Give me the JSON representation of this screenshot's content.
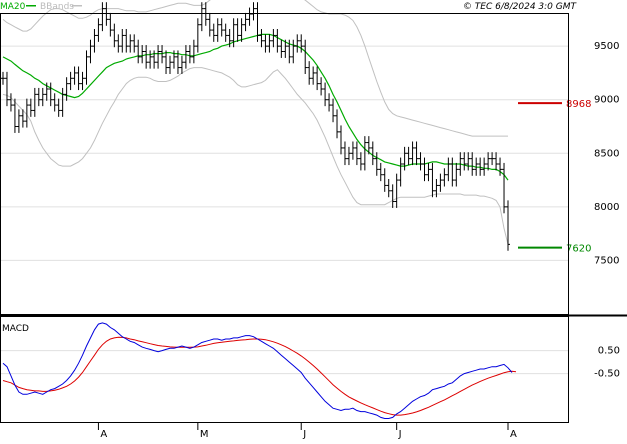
{
  "header": {
    "ma_label": "MA20",
    "bb_label": "BBands",
    "copyright": "© TEC 6/8/2024 3:0 GMT"
  },
  "colors": {
    "ma": "#00aa00",
    "bands": "#c0c0c0",
    "price": "#000000",
    "macd": "#0000dd",
    "signal": "#dd0000",
    "resistance": "#cc0000",
    "support": "#008800",
    "grid": "#e0e0e0",
    "axis": "#000000"
  },
  "chart_data": [
    {
      "type": "candlestick",
      "title": "",
      "ylim": [
        7000,
        9800
      ],
      "y_ticks": [
        7500,
        8000,
        8500,
        9000,
        9500
      ],
      "y_tick_labels": [
        "7500",
        "8000",
        "8500",
        "9000",
        "9500"
      ],
      "x_ticks": [
        {
          "index": 24,
          "label": "A"
        },
        {
          "index": 49,
          "label": "M"
        },
        {
          "index": 75,
          "label": "J"
        },
        {
          "index": 99,
          "label": "J"
        },
        {
          "index": 127,
          "label": "A"
        }
      ],
      "closes": [
        9200,
        9000,
        8950,
        8750,
        8850,
        8800,
        8950,
        8900,
        9050,
        9000,
        9050,
        9100,
        9000,
        8950,
        8900,
        9050,
        9150,
        9200,
        9250,
        9150,
        9200,
        9400,
        9500,
        9600,
        9700,
        9850,
        9750,
        9650,
        9550,
        9500,
        9600,
        9500,
        9550,
        9500,
        9400,
        9450,
        9350,
        9400,
        9350,
        9450,
        9400,
        9300,
        9350,
        9400,
        9300,
        9350,
        9450,
        9400,
        9500,
        9700,
        9850,
        9750,
        9650,
        9600,
        9700,
        9650,
        9600,
        9550,
        9700,
        9600,
        9700,
        9750,
        9800,
        9850,
        9600,
        9550,
        9500,
        9550,
        9600,
        9500,
        9450,
        9500,
        9400,
        9500,
        9550,
        9500,
        9300,
        9200,
        9250,
        9150,
        9100,
        9000,
        8950,
        8850,
        8700,
        8550,
        8450,
        8500,
        8550,
        8450,
        8400,
        8600,
        8550,
        8450,
        8350,
        8300,
        8200,
        8150,
        8050,
        8250,
        8400,
        8500,
        8450,
        8550,
        8450,
        8400,
        8300,
        8350,
        8150,
        8200,
        8250,
        8300,
        8400,
        8250,
        8350,
        8450,
        8400,
        8450,
        8350,
        8400,
        8350,
        8400,
        8450,
        8450,
        8400,
        8350,
        8000,
        7650
      ],
      "series": [
        {
          "name": "MA20",
          "values": [
            9400,
            9380,
            9360,
            9330,
            9300,
            9270,
            9250,
            9230,
            9200,
            9180,
            9150,
            9130,
            9110,
            9090,
            9070,
            9050,
            9040,
            9030,
            9020,
            9030,
            9060,
            9100,
            9140,
            9180,
            9220,
            9260,
            9300,
            9320,
            9340,
            9350,
            9360,
            9380,
            9390,
            9400,
            9410,
            9410,
            9420,
            9420,
            9430,
            9430,
            9430,
            9440,
            9440,
            9430,
            9430,
            9420,
            9420,
            9410,
            9410,
            9420,
            9430,
            9440,
            9450,
            9470,
            9480,
            9500,
            9510,
            9520,
            9540,
            9550,
            9560,
            9570,
            9580,
            9590,
            9600,
            9610,
            9610,
            9610,
            9600,
            9580,
            9560,
            9540,
            9520,
            9510,
            9500,
            9480,
            9450,
            9410,
            9370,
            9320,
            9260,
            9200,
            9130,
            9050,
            8980,
            8900,
            8820,
            8750,
            8690,
            8630,
            8580,
            8540,
            8510,
            8480,
            8460,
            8440,
            8420,
            8410,
            8400,
            8390,
            8380,
            8380,
            8390,
            8400,
            8400,
            8400,
            8400,
            8410,
            8420,
            8420,
            8410,
            8400,
            8400,
            8400,
            8400,
            8400,
            8390,
            8380,
            8380,
            8370,
            8370,
            8360,
            8360,
            8350,
            8350,
            8330,
            8300,
            8250
          ]
        },
        {
          "name": "BBands upper",
          "values": [
            9750,
            9720,
            9700,
            9680,
            9660,
            9640,
            9640,
            9660,
            9700,
            9740,
            9780,
            9810,
            9840,
            9850,
            9850,
            9840,
            9820,
            9800,
            9780,
            9760,
            9760,
            9770,
            9790,
            9820,
            9840,
            9850,
            9850,
            9850,
            9850,
            9850,
            9840,
            9830,
            9830,
            9830,
            9820,
            9820,
            9820,
            9830,
            9840,
            9850,
            9860,
            9870,
            9880,
            9890,
            9900,
            9900,
            9900,
            9890,
            9880,
            9880,
            9880,
            9900,
            9930,
            9950,
            9960,
            9970,
            9980,
            9990,
            10000,
            10000,
            10000,
            10000,
            10000,
            10000,
            10000,
            9990,
            9980,
            9970,
            9970,
            9990,
            10000,
            9990,
            9980,
            9970,
            9960,
            9950,
            9930,
            9900,
            9870,
            9840,
            9820,
            9810,
            9800,
            9800,
            9800,
            9800,
            9790,
            9770,
            9740,
            9680,
            9600,
            9500,
            9390,
            9280,
            9170,
            9070,
            8980,
            8910,
            8870,
            8850,
            8840,
            8830,
            8820,
            8810,
            8800,
            8790,
            8780,
            8770,
            8760,
            8750,
            8740,
            8730,
            8720,
            8710,
            8700,
            8690,
            8680,
            8670,
            8660,
            8660,
            8660,
            8660,
            8660,
            8660,
            8660,
            8660,
            8660,
            8660
          ]
        },
        {
          "name": "BBands lower",
          "values": [
            9050,
            9040,
            9020,
            8980,
            8940,
            8900,
            8860,
            8800,
            8700,
            8620,
            8550,
            8500,
            8450,
            8420,
            8390,
            8380,
            8380,
            8380,
            8400,
            8420,
            8450,
            8500,
            8550,
            8620,
            8700,
            8780,
            8850,
            8920,
            8980,
            9050,
            9100,
            9150,
            9180,
            9200,
            9210,
            9210,
            9210,
            9200,
            9180,
            9170,
            9170,
            9170,
            9180,
            9200,
            9220,
            9250,
            9270,
            9290,
            9300,
            9300,
            9300,
            9290,
            9280,
            9270,
            9260,
            9250,
            9230,
            9210,
            9180,
            9140,
            9120,
            9120,
            9130,
            9140,
            9150,
            9160,
            9180,
            9220,
            9260,
            9280,
            9240,
            9200,
            9150,
            9100,
            9050,
            9010,
            8970,
            8920,
            8870,
            8810,
            8730,
            8650,
            8560,
            8470,
            8380,
            8300,
            8230,
            8160,
            8090,
            8040,
            8020,
            8020,
            8020,
            8020,
            8020,
            8020,
            8020,
            8040,
            8060,
            8080,
            8090,
            8090,
            8090,
            8090,
            8090,
            8090,
            8090,
            8100,
            8110,
            8120,
            8120,
            8120,
            8120,
            8120,
            8120,
            8120,
            8110,
            8110,
            8110,
            8110,
            8100,
            8100,
            8090,
            8080,
            8060,
            8000,
            7800,
            7650
          ]
        }
      ],
      "annotations": [
        {
          "label": "8968",
          "value": 8968,
          "role": "resistance"
        },
        {
          "label": "7620",
          "value": 7620,
          "role": "support"
        }
      ]
    },
    {
      "type": "line",
      "title": "MACD",
      "ylim": [
        -260,
        200
      ],
      "y_ticks": [
        50,
        -50
      ],
      "y_tick_labels": [
        "0.50",
        "-0.50"
      ],
      "series": [
        {
          "name": "MACD",
          "values": [
            -5,
            -20,
            -60,
            -100,
            -130,
            -140,
            -140,
            -135,
            -130,
            -135,
            -140,
            -130,
            -120,
            -115,
            -105,
            -95,
            -80,
            -60,
            -35,
            -5,
            30,
            70,
            105,
            140,
            165,
            170,
            165,
            150,
            140,
            125,
            110,
            100,
            90,
            85,
            75,
            65,
            60,
            55,
            50,
            45,
            50,
            55,
            60,
            60,
            65,
            70,
            65,
            60,
            65,
            75,
            85,
            90,
            95,
            100,
            100,
            95,
            100,
            100,
            105,
            105,
            110,
            115,
            115,
            110,
            100,
            90,
            80,
            70,
            60,
            45,
            30,
            15,
            0,
            -15,
            -30,
            -45,
            -70,
            -90,
            -110,
            -130,
            -150,
            -170,
            -185,
            -200,
            -205,
            -210,
            -205,
            -205,
            -200,
            -210,
            -215,
            -215,
            -220,
            -225,
            -230,
            -240,
            -245,
            -245,
            -240,
            -225,
            -215,
            -200,
            -185,
            -170,
            -160,
            -150,
            -145,
            -135,
            -120,
            -115,
            -110,
            -105,
            -95,
            -90,
            -75,
            -60,
            -50,
            -45,
            -40,
            -35,
            -30,
            -30,
            -25,
            -20,
            -20,
            -15,
            -10,
            -25,
            -45
          ]
        },
        {
          "name": "Signal",
          "values": [
            -80,
            -85,
            -90,
            -100,
            -110,
            -115,
            -120,
            -122,
            -125,
            -125,
            -127,
            -127,
            -125,
            -122,
            -118,
            -112,
            -105,
            -95,
            -82,
            -65,
            -45,
            -20,
            5,
            30,
            55,
            75,
            90,
            100,
            105,
            108,
            107,
            105,
            100,
            97,
            92,
            88,
            84,
            80,
            76,
            72,
            70,
            68,
            66,
            65,
            64,
            64,
            64,
            64,
            65,
            66,
            70,
            73,
            77,
            81,
            84,
            86,
            88,
            90,
            92,
            94,
            96,
            97,
            99,
            100,
            100,
            99,
            97,
            93,
            88,
            82,
            75,
            67,
            58,
            48,
            38,
            27,
            14,
            0,
            -15,
            -30,
            -47,
            -64,
            -81,
            -98,
            -113,
            -127,
            -140,
            -151,
            -160,
            -169,
            -177,
            -185,
            -192,
            -199,
            -206,
            -213,
            -219,
            -224,
            -228,
            -230,
            -230,
            -228,
            -225,
            -221,
            -216,
            -210,
            -203,
            -196,
            -188,
            -180,
            -172,
            -164,
            -155,
            -146,
            -137,
            -127,
            -118,
            -109,
            -100,
            -92,
            -84,
            -77,
            -70,
            -64,
            -58,
            -52,
            -46,
            -42,
            -40,
            -42
          ]
        }
      ]
    }
  ]
}
